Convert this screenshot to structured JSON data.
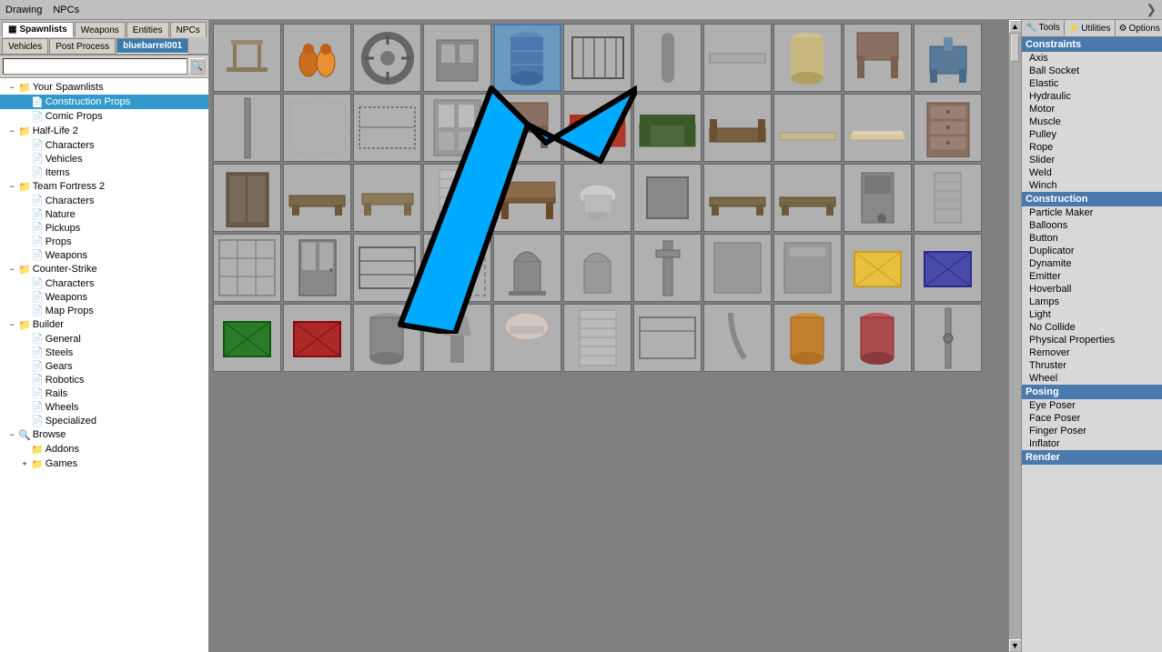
{
  "menubar": {
    "items": [
      "Drawing",
      "NPCs"
    ],
    "arrow": "❯"
  },
  "tabs": [
    {
      "label": "Spawnlists",
      "icon": "▦",
      "active": true
    },
    {
      "label": "Weapons",
      "icon": "🔫",
      "active": false
    },
    {
      "label": "Entities",
      "icon": "⚙",
      "active": false
    },
    {
      "label": "NPCs",
      "icon": "👤",
      "active": false
    },
    {
      "label": "Vehicles",
      "icon": "🚗",
      "active": false
    },
    {
      "label": "Post Process",
      "icon": "✦",
      "active": false
    },
    {
      "label": "bluebarrel001",
      "icon": "",
      "active": true,
      "highlight": true
    }
  ],
  "search": {
    "placeholder": "",
    "button_icon": "🔍"
  },
  "tree": {
    "items": [
      {
        "id": "your-spawnlists",
        "label": "Your Spawnlists",
        "indent": 1,
        "toggle": "−",
        "icon": "📁",
        "expanded": true
      },
      {
        "id": "construction-props",
        "label": "Construction Props",
        "indent": 2,
        "toggle": "",
        "icon": "📄",
        "selected": true
      },
      {
        "id": "comic-props",
        "label": "Comic Props",
        "indent": 2,
        "toggle": "",
        "icon": "📄"
      },
      {
        "id": "half-life-2",
        "label": "Half-Life 2",
        "indent": 1,
        "toggle": "−",
        "icon": "📁",
        "expanded": true
      },
      {
        "id": "hl2-characters",
        "label": "Characters",
        "indent": 3,
        "toggle": "",
        "icon": "📄"
      },
      {
        "id": "hl2-vehicles",
        "label": "Vehicles",
        "indent": 3,
        "toggle": "",
        "icon": "📄"
      },
      {
        "id": "hl2-items",
        "label": "Items",
        "indent": 3,
        "toggle": "",
        "icon": "📄"
      },
      {
        "id": "team-fortress",
        "label": "Team Fortress 2",
        "indent": 1,
        "toggle": "−",
        "icon": "📁",
        "expanded": true
      },
      {
        "id": "tf2-characters",
        "label": "Characters",
        "indent": 3,
        "toggle": "",
        "icon": "📄"
      },
      {
        "id": "tf2-nature",
        "label": "Nature",
        "indent": 3,
        "toggle": "",
        "icon": "📄"
      },
      {
        "id": "tf2-pickups",
        "label": "Pickups",
        "indent": 3,
        "toggle": "",
        "icon": "📄"
      },
      {
        "id": "tf2-props",
        "label": "Props",
        "indent": 3,
        "toggle": "",
        "icon": "📄"
      },
      {
        "id": "tf2-weapons",
        "label": "Weapons",
        "indent": 3,
        "toggle": "",
        "icon": "📄"
      },
      {
        "id": "counter-strike",
        "label": "Counter-Strike",
        "indent": 1,
        "toggle": "−",
        "icon": "📁",
        "expanded": true
      },
      {
        "id": "cs-characters",
        "label": "Characters",
        "indent": 3,
        "toggle": "",
        "icon": "📄"
      },
      {
        "id": "cs-weapons",
        "label": "Weapons",
        "indent": 3,
        "toggle": "",
        "icon": "📄"
      },
      {
        "id": "cs-map-props",
        "label": "Map Props",
        "indent": 3,
        "toggle": "",
        "icon": "📄"
      },
      {
        "id": "builder",
        "label": "Builder",
        "indent": 1,
        "toggle": "−",
        "icon": "📁",
        "expanded": true
      },
      {
        "id": "builder-general",
        "label": "General",
        "indent": 3,
        "toggle": "",
        "icon": "📄"
      },
      {
        "id": "builder-steels",
        "label": "Steels",
        "indent": 3,
        "toggle": "",
        "icon": "📄"
      },
      {
        "id": "builder-gears",
        "label": "Gears",
        "indent": 3,
        "toggle": "",
        "icon": "📄"
      },
      {
        "id": "builder-robotics",
        "label": "Robotics",
        "indent": 3,
        "toggle": "",
        "icon": "📄"
      },
      {
        "id": "builder-rails",
        "label": "Rails",
        "indent": 3,
        "toggle": "",
        "icon": "📄"
      },
      {
        "id": "builder-wheels",
        "label": "Wheels",
        "indent": 3,
        "toggle": "",
        "icon": "📄"
      },
      {
        "id": "builder-specialized",
        "label": "Specialized",
        "indent": 3,
        "toggle": "",
        "icon": "📄"
      },
      {
        "id": "browse",
        "label": "Browse",
        "indent": 1,
        "toggle": "−",
        "icon": "🔍",
        "expanded": true
      },
      {
        "id": "addons",
        "label": "Addons",
        "indent": 2,
        "toggle": "",
        "icon": "📁"
      },
      {
        "id": "games",
        "label": "Games",
        "indent": 2,
        "toggle": "+",
        "icon": "📁"
      }
    ]
  },
  "right_panel": {
    "tabs": [
      {
        "label": "Tools",
        "icon": "🔧",
        "active": true
      },
      {
        "label": "Utilities",
        "icon": "⚡",
        "active": false
      },
      {
        "label": "Options",
        "icon": "⚙",
        "active": false
      }
    ],
    "sections": [
      {
        "name": "Constraints",
        "type": "constraints",
        "items": [
          "Axis",
          "Ball Socket",
          "Elastic",
          "Hydraulic",
          "Motor",
          "Muscle",
          "Pulley",
          "Rope",
          "Slider",
          "Weld",
          "Winch"
        ]
      },
      {
        "name": "Construction",
        "type": "construction",
        "items": [
          "Particle Maker",
          "Balloons",
          "Button",
          "Duplicator",
          "Dynamite",
          "Emitter",
          "Hoverball",
          "Lamps",
          "Light",
          "No Collide",
          "Physical Properties",
          "Remover",
          "Thruster",
          "Wheel"
        ]
      },
      {
        "name": "Posing",
        "type": "posing",
        "items": [
          "Eye Poser",
          "Face Poser",
          "Finger Poser",
          "Inflator"
        ]
      },
      {
        "name": "Render",
        "type": "render",
        "items": []
      }
    ]
  },
  "grid_items": [
    {
      "id": 1,
      "color": "#8a7a5a",
      "shape": "stool"
    },
    {
      "id": 2,
      "color": "#c87020",
      "shape": "barrels"
    },
    {
      "id": 3,
      "color": "#888",
      "shape": "wheel"
    },
    {
      "id": 4,
      "color": "#777",
      "shape": "panel"
    },
    {
      "id": 5,
      "color": "#4a7aad",
      "shape": "barrel-blue",
      "selected": true
    },
    {
      "id": 6,
      "color": "#555",
      "shape": "fence"
    },
    {
      "id": 7,
      "color": "#888",
      "shape": "pipe"
    },
    {
      "id": 8,
      "color": "#666",
      "shape": "long"
    },
    {
      "id": 9,
      "color": "#c8c090",
      "shape": "drum"
    },
    {
      "id": 10,
      "color": "#8a7060",
      "shape": "chair-wood"
    },
    {
      "id": 11,
      "color": "#5a7a5a",
      "shape": "chair-blue"
    },
    {
      "id": 12,
      "color": "#777",
      "shape": "pole"
    },
    {
      "id": 13,
      "color": "#aaa",
      "shape": "frame"
    },
    {
      "id": 14,
      "color": "#777",
      "shape": "fence2"
    },
    {
      "id": 15,
      "color": "#888",
      "shape": "wall"
    },
    {
      "id": 16,
      "color": "#8a7060",
      "shape": "chair2"
    },
    {
      "id": 17,
      "color": "#c04030",
      "shape": "sofa"
    },
    {
      "id": 18,
      "color": "#4a6a3a",
      "shape": "sofa2"
    },
    {
      "id": 19,
      "color": "#7a6040",
      "shape": "table"
    },
    {
      "id": 20,
      "color": "#c8b890",
      "shape": "mat"
    },
    {
      "id": 21,
      "color": "#d4c8a0",
      "shape": "mat2"
    },
    {
      "id": 22,
      "color": "#8a7060",
      "shape": "dresser"
    },
    {
      "id": 23,
      "color": "#6a5a4a",
      "shape": "cabinet"
    },
    {
      "id": 24,
      "color": "#7a6a4a",
      "shape": "table2"
    },
    {
      "id": 25,
      "color": "#8a7a5a",
      "shape": "table3"
    },
    {
      "id": 26,
      "color": "#aaa",
      "shape": "radiator"
    },
    {
      "id": 27,
      "color": "#7a5a3a",
      "shape": "desk"
    },
    {
      "id": 28,
      "color": "#aaa",
      "shape": "sink"
    },
    {
      "id": 29,
      "color": "#888",
      "shape": "box"
    },
    {
      "id": 30,
      "color": "#7a6a4a",
      "shape": "table4"
    },
    {
      "id": 31,
      "color": "#7a6a4a",
      "shape": "table5"
    },
    {
      "id": 32,
      "color": "#888",
      "shape": "stove"
    },
    {
      "id": 33,
      "color": "#888",
      "shape": "heater"
    },
    {
      "id": 34,
      "color": "#888",
      "shape": "gate"
    },
    {
      "id": 35,
      "color": "#888",
      "shape": "door"
    },
    {
      "id": 36,
      "color": "#888",
      "shape": "bars"
    },
    {
      "id": 37,
      "color": "#888",
      "shape": "gate2"
    },
    {
      "id": 38,
      "color": "#7a7a7a",
      "shape": "grave"
    },
    {
      "id": 39,
      "color": "#888",
      "shape": "grave2"
    },
    {
      "id": 40,
      "color": "#888",
      "shape": "pillar"
    },
    {
      "id": 41,
      "color": "#888",
      "shape": "panel2"
    },
    {
      "id": 42,
      "color": "#888",
      "shape": "panel3"
    },
    {
      "id": 43,
      "color": "#e8c040",
      "shape": "crate-y"
    },
    {
      "id": 44,
      "color": "#4a4aaa",
      "shape": "crate-b"
    },
    {
      "id": 45,
      "color": "#2a7a2a",
      "shape": "crate-g"
    },
    {
      "id": 46,
      "color": "#aa2a2a",
      "shape": "crate-r"
    },
    {
      "id": 47,
      "color": "#888",
      "shape": "barrel2"
    },
    {
      "id": 48,
      "color": "#888",
      "shape": "lamp"
    },
    {
      "id": 49,
      "color": "#c8c8c8",
      "shape": "lampshade"
    },
    {
      "id": 50,
      "color": "#aaa",
      "shape": "radiator2"
    },
    {
      "id": 51,
      "color": "#888",
      "shape": "fence3"
    },
    {
      "id": 52,
      "color": "#888",
      "shape": "pipe2"
    },
    {
      "id": 53,
      "color": "#c08030",
      "shape": "barrel3"
    },
    {
      "id": 54,
      "color": "#aa4a4a",
      "shape": "barrel4"
    },
    {
      "id": 55,
      "color": "#888",
      "shape": "pole2"
    }
  ]
}
